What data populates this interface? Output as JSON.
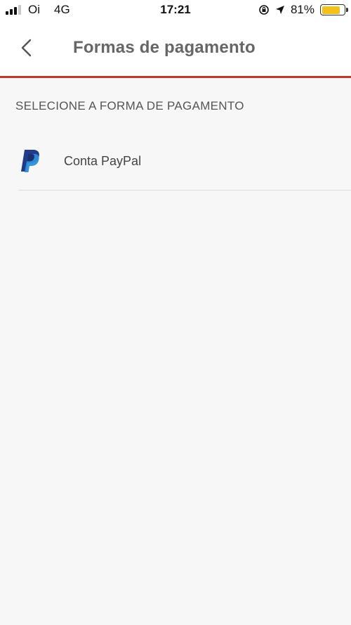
{
  "status_bar": {
    "carrier": "Oi",
    "network": "4G",
    "time": "17:21",
    "battery": "81%",
    "battery_level": 0.81,
    "battery_color": "#f2c21b",
    "icons": [
      "signal-icon",
      "rotation-lock-icon",
      "location-arrow-icon",
      "battery-icon"
    ]
  },
  "header": {
    "title": "Formas de pagamento",
    "back_icon": "chevron-left-icon",
    "accent_color": "#c0392b"
  },
  "main": {
    "section_title": "SELECIONE A FORMA DE PAGAMENTO",
    "payment_methods": [
      {
        "label": "Conta PayPal",
        "icon": "paypal-icon"
      }
    ]
  }
}
